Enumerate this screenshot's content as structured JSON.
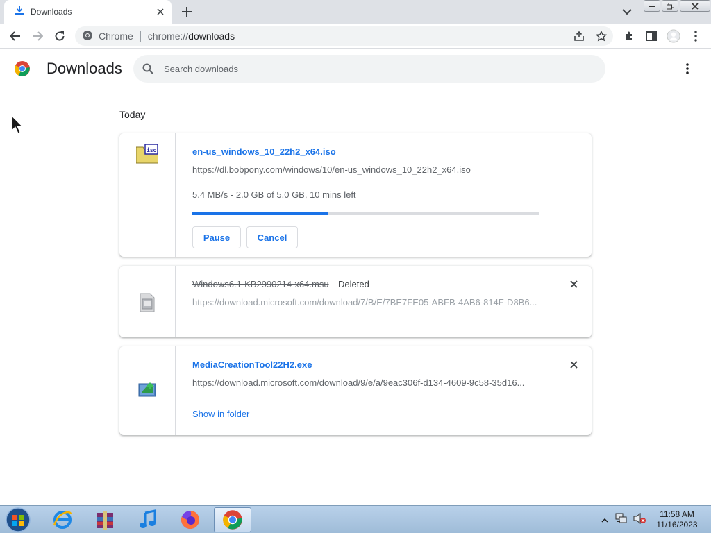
{
  "tab": {
    "title": "Downloads"
  },
  "toolbar": {
    "site_label": "Chrome",
    "url_scheme": "chrome://",
    "url_path": "downloads"
  },
  "page": {
    "title": "Downloads",
    "search_placeholder": "Search downloads",
    "section_date": "Today"
  },
  "downloads": [
    {
      "file_name": "en-us_windows_10_22h2_x64.iso",
      "url": "https://dl.bobpony.com/windows/10/en-us_windows_10_22h2_x64.iso",
      "status": "5.4 MB/s - 2.0 GB of 5.0 GB, 10 mins left",
      "progress_fraction": 0.39,
      "pause_label": "Pause",
      "cancel_label": "Cancel",
      "icon": "iso-file-icon"
    },
    {
      "file_name": "Windows6.1-KB2990214-x64.msu",
      "tag": "Deleted",
      "url": "https://download.microsoft.com/download/7/B/E/7BE7FE05-ABFB-4AB6-814F-D8B6...",
      "icon": "msu-file-icon"
    },
    {
      "file_name": "MediaCreationTool22H2.exe",
      "url": "https://download.microsoft.com/download/9/e/a/9eac306f-d134-4609-9c58-35d16...",
      "show_folder_label": "Show in folder",
      "icon": "exe-file-icon"
    }
  ],
  "taskbar": {
    "apps": [
      "ie-icon",
      "winrar-icon",
      "itunes-icon",
      "firefox-icon",
      "chrome-icon"
    ],
    "time": "11:58 AM",
    "date": "11/16/2023"
  },
  "colors": {
    "accent": "#1a73e8",
    "tabstrip": "#dee1e6",
    "omnibox": "#f1f3f4"
  }
}
